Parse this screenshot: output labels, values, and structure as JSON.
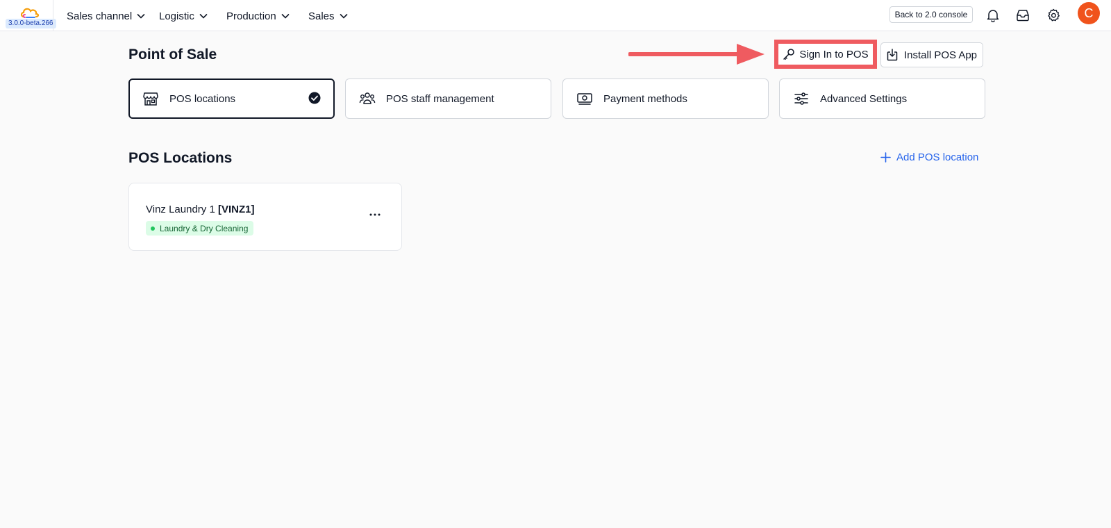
{
  "app": {
    "version": "3.0.0-beta.266"
  },
  "nav": {
    "items": [
      {
        "label": "Sales channel"
      },
      {
        "label": "Logistic"
      },
      {
        "label": "Production"
      },
      {
        "label": "Sales"
      }
    ],
    "back_label": "Back to 2.0 console",
    "avatar_initial": "C"
  },
  "header": {
    "title": "Point of Sale",
    "signin_label": "Sign In to POS",
    "install_label": "Install POS App"
  },
  "tabs": [
    {
      "label": "POS locations",
      "icon": "store-icon",
      "active": true
    },
    {
      "label": "POS staff management",
      "icon": "users-icon",
      "active": false
    },
    {
      "label": "Payment methods",
      "icon": "money-icon",
      "active": false
    },
    {
      "label": "Advanced Settings",
      "icon": "sliders-icon",
      "active": false
    }
  ],
  "locations_section": {
    "title": "POS Locations",
    "add_label": "Add POS location",
    "items": [
      {
        "name": "Vinz Laundry 1 ",
        "code": "[VINZ1]",
        "category": "Laundry & Dry Cleaning"
      }
    ]
  },
  "colors": {
    "accent": "#2563eb",
    "highlight": "#ef5b60",
    "avatar": "#f0531c",
    "badge_bg": "#dcfce7",
    "badge_text": "#166534"
  }
}
